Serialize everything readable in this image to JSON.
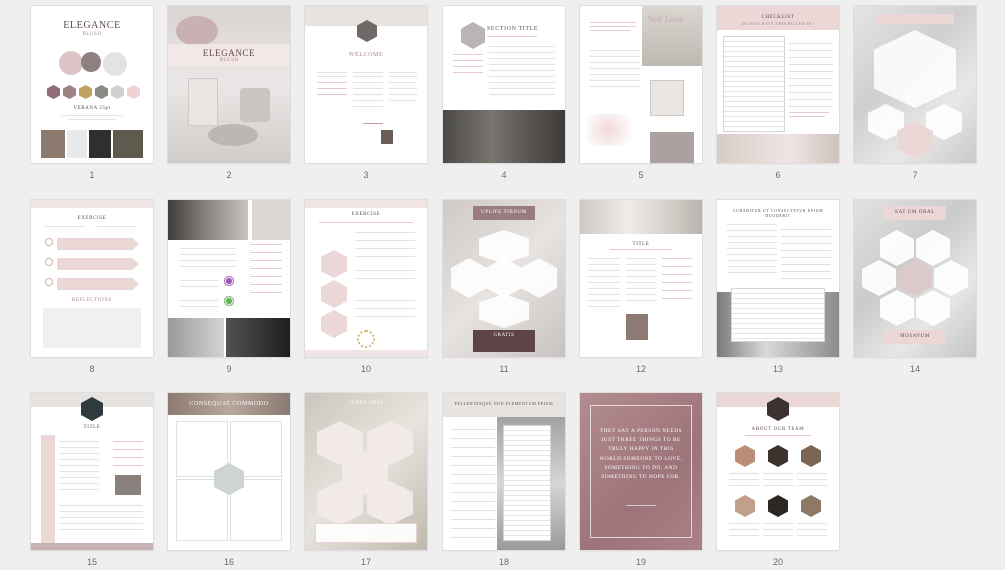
{
  "pages": [
    {
      "num": "1",
      "title": "ELEGANCE",
      "sub": "BLUSH",
      "note": "VERANA 25pt"
    },
    {
      "num": "2",
      "title": "ELEGANCE",
      "sub": "BLUSH"
    },
    {
      "num": "3",
      "title": "WELCOME"
    },
    {
      "num": "4",
      "title": "SECTION TITLE"
    },
    {
      "num": "5",
      "title": "Self Love"
    },
    {
      "num": "6",
      "title": "CHECKLIST",
      "sub": "DO YOU HAVE THIS BILLED IN?"
    },
    {
      "num": "7"
    },
    {
      "num": "8",
      "title": "EXERCISE",
      "sub": "REFLECTIONS"
    },
    {
      "num": "9"
    },
    {
      "num": "10",
      "title": "EXERCISE"
    },
    {
      "num": "11",
      "title": "UPLIFE TIBNUM",
      "sub": "GRATIS"
    },
    {
      "num": "12",
      "title": "TITLE"
    },
    {
      "num": "13",
      "title": "CURABITUR UT CONSECTETUR EPIUM DUODERIT"
    },
    {
      "num": "14",
      "title": "EAT UM ORAL",
      "sub": "MOSAYUM"
    },
    {
      "num": "15",
      "title": "TITLE"
    },
    {
      "num": "16",
      "title": "CONSEQUAT COMMODO"
    },
    {
      "num": "17",
      "title": "JUSTO ORCI"
    },
    {
      "num": "18",
      "title": "PELLENTESQUE NON ELEMENTUM EPIUM"
    },
    {
      "num": "19",
      "quote": "THEY SAY A PERSON NEEDS JUST THREE THINGS TO BE TRULY HAPPY IN THIS WORLD SOMEONE TO LOVE, SOMETHING TO DO, AND SOMETHING TO HOPE FOR."
    },
    {
      "num": "20",
      "title": "ABOUT OUR TEAM"
    }
  ],
  "colors": {
    "background": "#efefef",
    "blush": "#ecd7d7",
    "mauve": "#a97f84",
    "dark": "#5c4a4c",
    "grey_photo": "#8c8c8c"
  }
}
